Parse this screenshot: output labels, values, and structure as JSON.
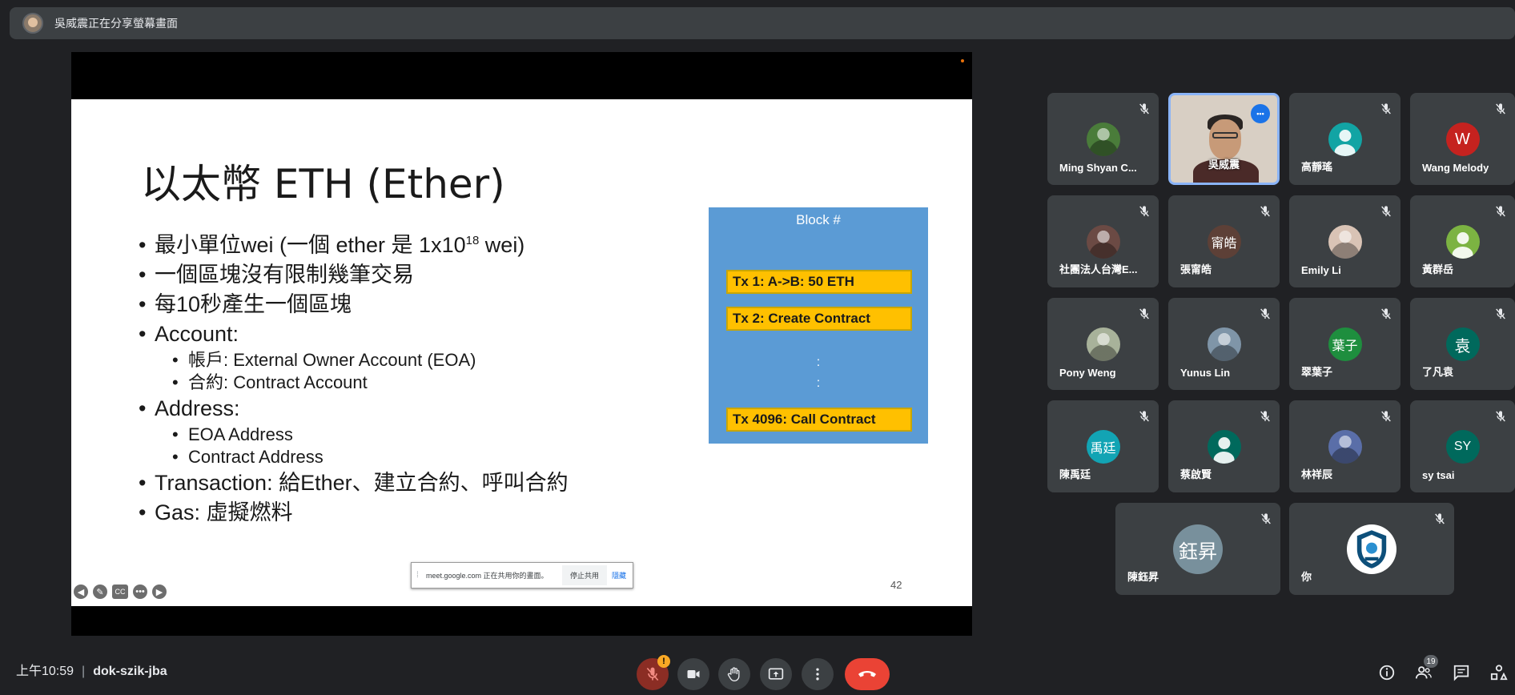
{
  "banner": {
    "text": "吳威震正在分享螢幕畫面"
  },
  "slide": {
    "title": "以太幣 ETH (Ether)",
    "bullets": {
      "b1_pre": "最小單位wei (一個 ether 是 1x10",
      "b1_sup": "18",
      "b1_post": " wei)",
      "b2": "一個區塊沒有限制幾筆交易",
      "b3": "每10秒產生一個區塊",
      "b4": "Account:",
      "b4_1": "帳戶: External Owner Account (EOA)",
      "b4_2": "合約: Contract Account",
      "b5": "Address:",
      "b5_1": "EOA Address",
      "b5_2": "Contract Address",
      "b6": "Transaction: 給Ether、建立合約、呼叫合約",
      "b7": "Gas: 虛擬燃料"
    },
    "block": {
      "title": "Block #",
      "tx1": "Tx 1: A->B: 50 ETH",
      "tx2": "Tx 2: Create  Contract",
      "tx3": "Tx 4096: Call Contract",
      "dots": ":"
    },
    "page_number": "42"
  },
  "share_notice": {
    "message": "meet.google.com 正在共用你的畫面。",
    "stop": "停止共用",
    "hide": "隱藏"
  },
  "participants": [
    {
      "name": "Ming Shyan C...",
      "avatar_type": "image",
      "color": "#4a7c3a",
      "initial": ""
    },
    {
      "name": "吳威震",
      "avatar_type": "video",
      "color": "",
      "initial": ""
    },
    {
      "name": "高靜瑤",
      "avatar_type": "silhouette",
      "color": "#12a4a4",
      "initial": ""
    },
    {
      "name": "Wang Melody",
      "avatar_type": "initial",
      "color": "#c5221f",
      "initial": "W"
    },
    {
      "name": "社團法人台灣E...",
      "avatar_type": "image",
      "color": "#6b4a44",
      "initial": ""
    },
    {
      "name": "張甯皓",
      "avatar_type": "initial",
      "color": "#5d4037",
      "initial": "甯皓"
    },
    {
      "name": "Emily Li",
      "avatar_type": "image",
      "color": "#d9c3b5",
      "initial": ""
    },
    {
      "name": "黃群岳",
      "avatar_type": "silhouette",
      "color": "#7cb342",
      "initial": ""
    },
    {
      "name": "Pony Weng",
      "avatar_type": "image",
      "color": "#a8b29a",
      "initial": ""
    },
    {
      "name": "Yunus Lin",
      "avatar_type": "image",
      "color": "#7f95a8",
      "initial": ""
    },
    {
      "name": "翠葉子",
      "avatar_type": "initial",
      "color": "#1e8e3e",
      "initial": "葉子"
    },
    {
      "name": "了凡袁",
      "avatar_type": "initial",
      "color": "#00695c",
      "initial": "袁"
    },
    {
      "name": "陳禹廷",
      "avatar_type": "initial",
      "color": "#12a4b4",
      "initial": "禹廷"
    },
    {
      "name": "蔡啟賢",
      "avatar_type": "silhouette",
      "color": "#00695c",
      "initial": ""
    },
    {
      "name": "林祥辰",
      "avatar_type": "image",
      "color": "#5a6ea8",
      "initial": ""
    },
    {
      "name": "sy tsai",
      "avatar_type": "initial",
      "color": "#00695c",
      "initial": "SY"
    },
    {
      "name": "陳鈺昇",
      "avatar_type": "initial",
      "color": "#78909c",
      "initial": "鈺昇"
    },
    {
      "name": "你",
      "avatar_type": "image",
      "color": "#ffffff",
      "initial": ""
    }
  ],
  "bottom_bar": {
    "time": "上午10:59",
    "meeting_code": "dok-szik-jba",
    "mic_alert": "!",
    "people_count": "19"
  },
  "colors": {
    "background": "#202124",
    "tile": "#3c4043",
    "accent_blue": "#1a73e8",
    "hangup_red": "#ea4335",
    "block_blue": "#5b9bd5",
    "tx_gold": "#ffc000"
  }
}
